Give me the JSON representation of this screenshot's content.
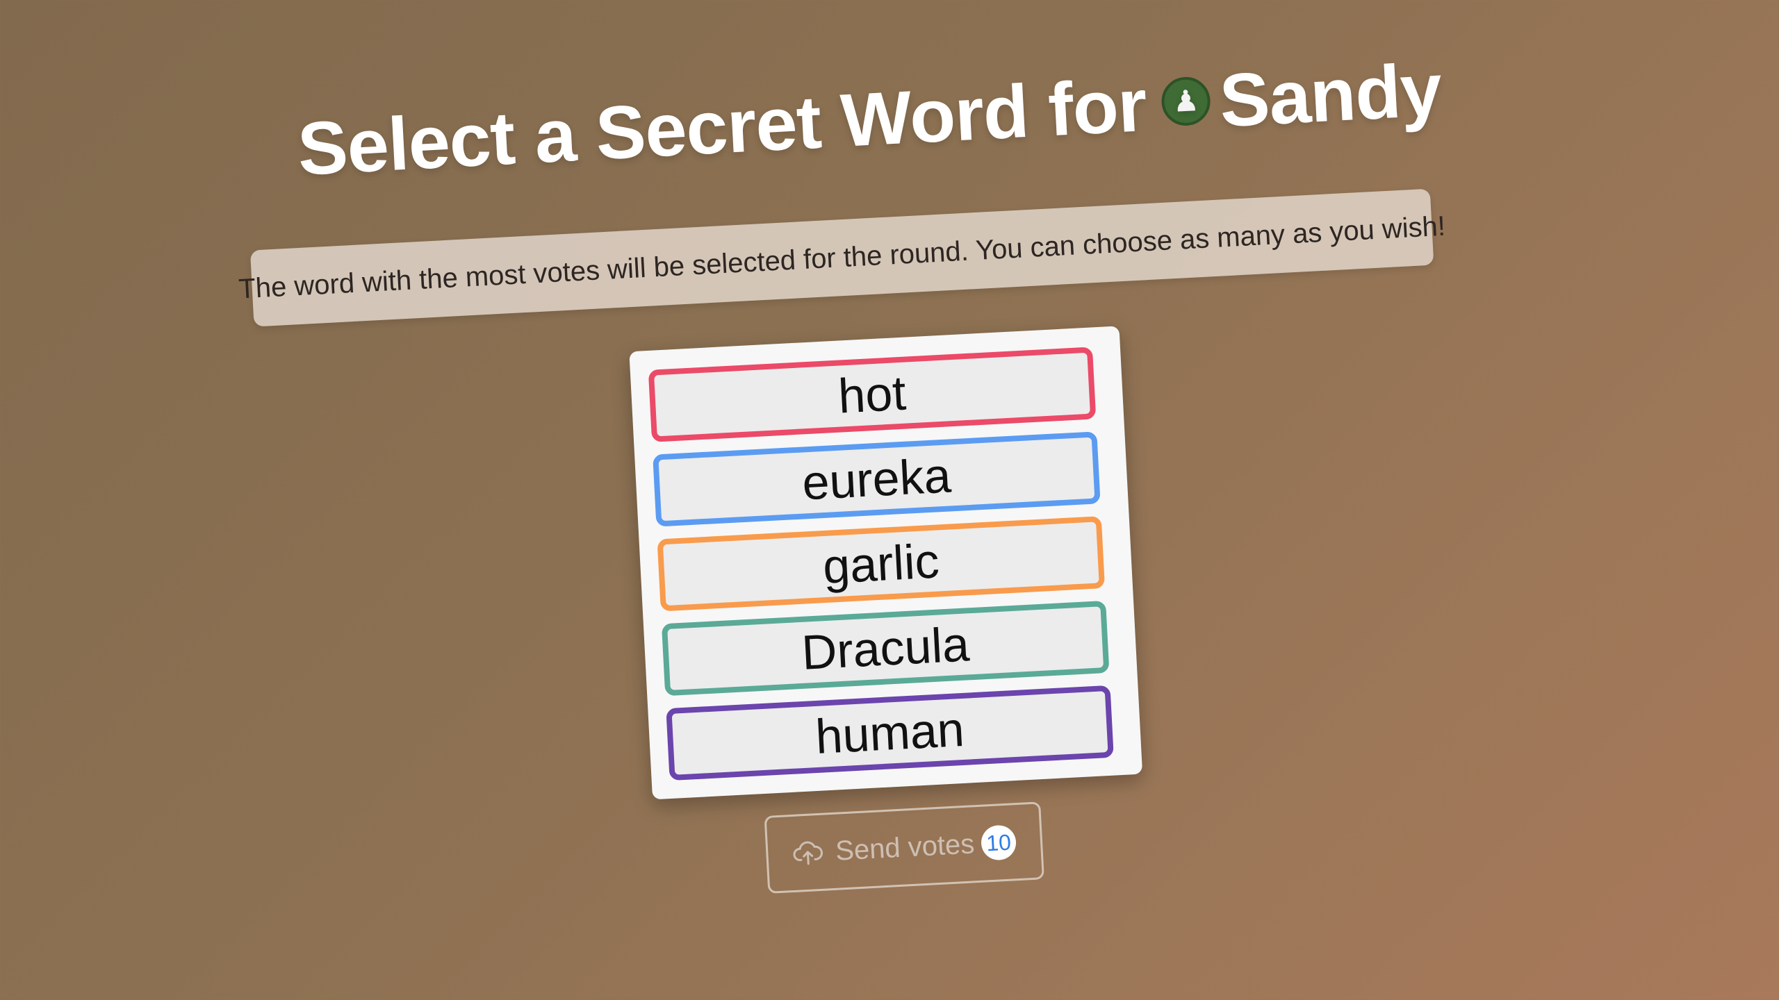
{
  "header": {
    "title_prefix": "Select a Secret Word for",
    "player_name": "Sandy",
    "player_avatar_glyph": "♟"
  },
  "subtitle": "The word with the most votes will be selected for the round. You can choose as many as you wish!",
  "words": [
    {
      "label": "hot",
      "color": "#eb4a68"
    },
    {
      "label": "eureka",
      "color": "#5b9cf2"
    },
    {
      "label": "garlic",
      "color": "#f99b4c"
    },
    {
      "label": "Dracula",
      "color": "#5aaa97"
    },
    {
      "label": "human",
      "color": "#6b44ad"
    }
  ],
  "send_button": {
    "label": "Send votes",
    "count": "10",
    "icon": "cloud-upload-icon"
  },
  "colors": {
    "background": "#8d7152",
    "avatar": "#3f6b35",
    "count_text": "#2f7de1"
  }
}
